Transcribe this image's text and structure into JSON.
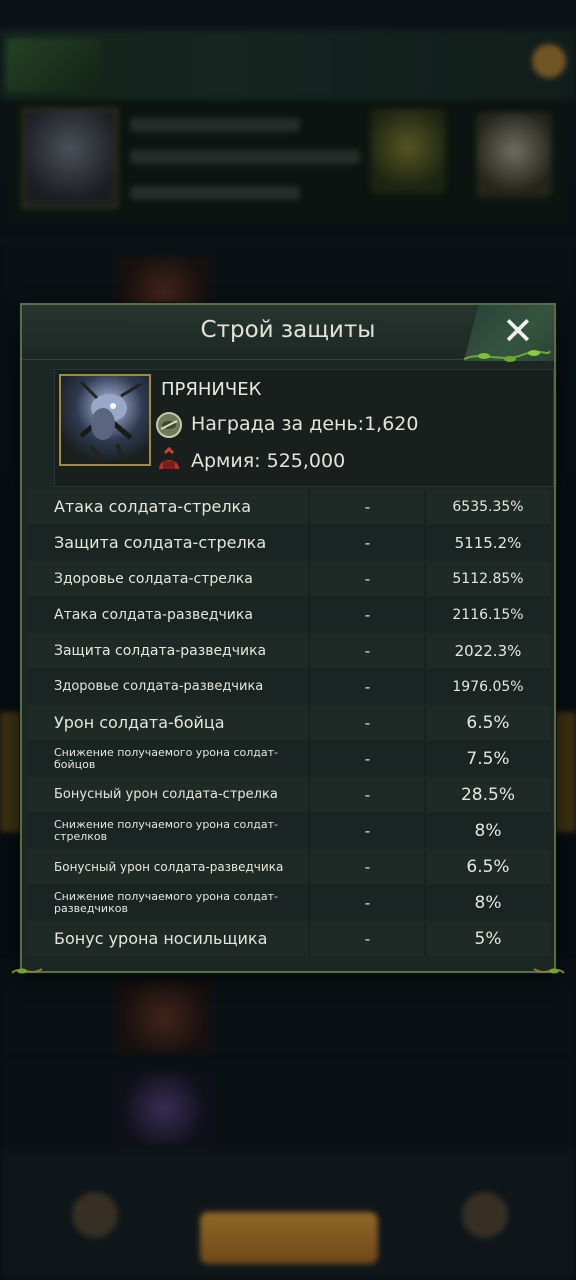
{
  "modal": {
    "title": "Строй защиты",
    "close_label": "✕"
  },
  "profile": {
    "name": "ПРЯНИЧЕК",
    "reward": "Награда за день:1,620",
    "army": "Армия: 525,000"
  },
  "stats": [
    {
      "name": "Атака солдата-стрелка",
      "mid": "-",
      "value": "6535.35%"
    },
    {
      "name": "Защита солдата-стрелка",
      "mid": "-",
      "value": "5115.2%"
    },
    {
      "name": "Здоровье солдата-стрелка",
      "mid": "-",
      "value": "5112.85%"
    },
    {
      "name": "Атака солдата-разведчика",
      "mid": "-",
      "value": "2116.15%"
    },
    {
      "name": "Защита солдата-разведчика",
      "mid": "-",
      "value": "2022.3%"
    },
    {
      "name": "Здоровье солдата-разведчика",
      "mid": "-",
      "value": "1976.05%"
    },
    {
      "name": "Урон солдата-бойца",
      "mid": "-",
      "value": "6.5%"
    },
    {
      "name": "Снижение получаемого урона солдат-бойцов",
      "mid": "-",
      "value": "7.5%"
    },
    {
      "name": "Бонусный урон солдата-стрелка",
      "mid": "-",
      "value": "28.5%"
    },
    {
      "name": "Снижение получаемого урона солдат-стрелков",
      "mid": "-",
      "value": "8%"
    },
    {
      "name": "Бонусный урон солдата-разведчика",
      "mid": "-",
      "value": "6.5%"
    },
    {
      "name": "Снижение получаемого урона солдат-разведчиков",
      "mid": "-",
      "value": "8%"
    },
    {
      "name": "Бонус урона носильщика",
      "mid": "-",
      "value": "5%"
    }
  ],
  "colors": {
    "panel_bg": "#1c2623",
    "panel_border": "#5b6a4a",
    "text": "#e6e6dc",
    "accent_gold": "#a08a48",
    "vine_green": "#6aa832"
  },
  "icons": {
    "close": "close-icon",
    "reward": "reward-coin-icon",
    "army": "army-helmet-icon"
  }
}
